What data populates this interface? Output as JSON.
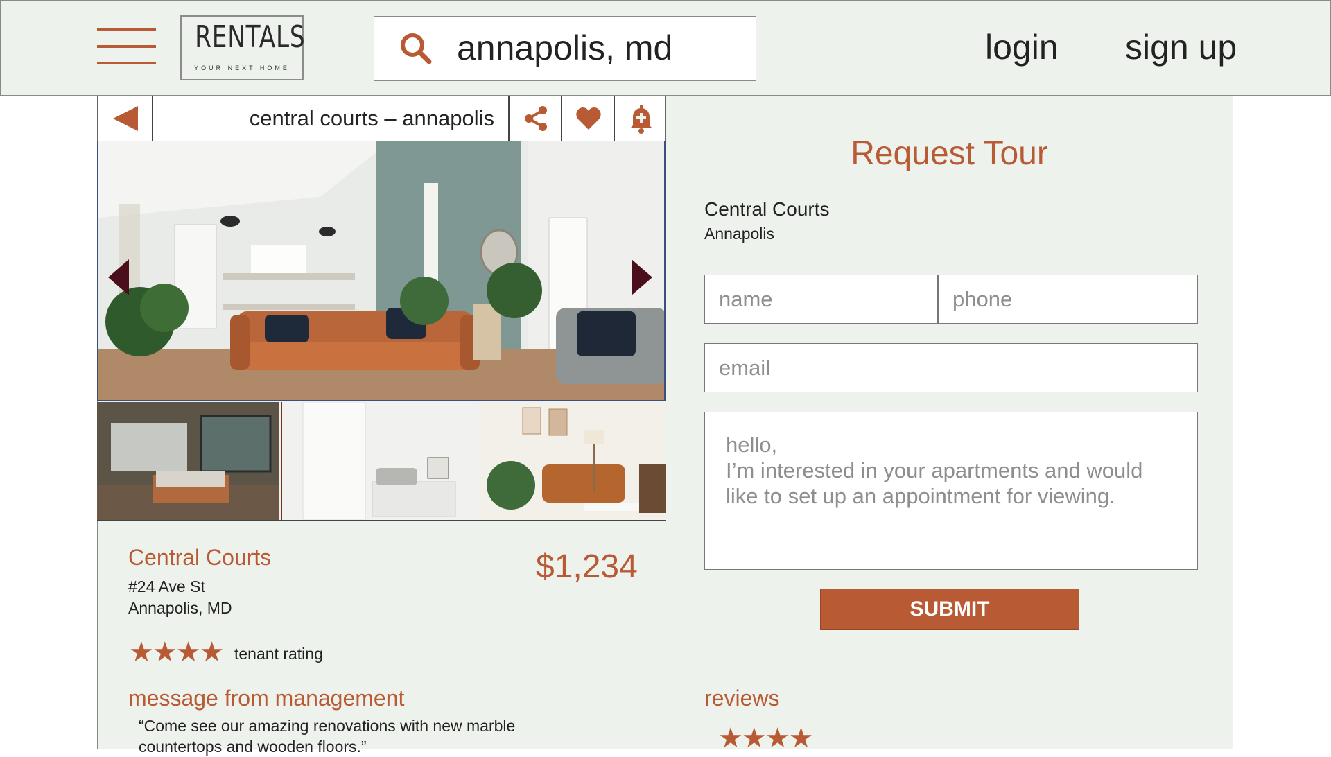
{
  "header": {
    "logo_title": "RENTALS",
    "logo_subtitle": "YOUR NEXT HOME",
    "search_value": "annapolis, md",
    "login_label": "login",
    "signup_label": "sign up"
  },
  "listing": {
    "bar_title": "central courts – annapolis",
    "name": "Central Courts",
    "price": "$1,234",
    "address_line1": "#24 Ave St",
    "address_line2": "Annapolis, MD",
    "rating_stars": 4,
    "rating_stars_text": "★★★★",
    "rating_label": "tenant rating",
    "message_title": "message from management",
    "message_text": "“Come see our amazing renovations with new marble countertops and wooden floors.”"
  },
  "tour_form": {
    "title": "Request Tour",
    "property_name": "Central Courts",
    "property_city": "Annapolis",
    "name_placeholder": "name",
    "phone_placeholder": "phone",
    "email_placeholder": "email",
    "message_value": "hello,\nI’m interested in your apartments and would like to set up an appointment for viewing.",
    "submit_label": "SUBMIT"
  },
  "reviews": {
    "title": "reviews",
    "stars_text": "★★★★"
  },
  "colors": {
    "accent": "#b85a33",
    "panel_bg": "#eef2ec",
    "arrow": "#4a0f1a"
  },
  "icons": [
    "menu-icon",
    "search-icon",
    "back-arrow-icon",
    "share-icon",
    "heart-icon",
    "bell-plus-icon",
    "chevron-left-icon",
    "chevron-right-icon"
  ]
}
